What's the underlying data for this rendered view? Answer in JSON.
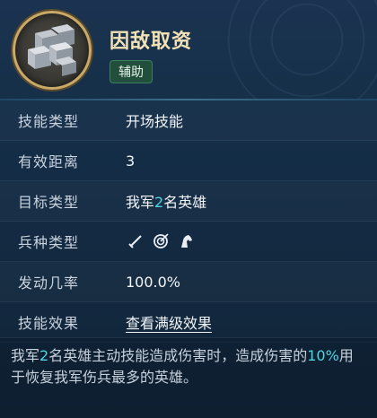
{
  "skill": {
    "name": "因敌取资",
    "tag": "辅助",
    "icon": "stacked-ingots-icon"
  },
  "rows": [
    {
      "key": "技能类型",
      "value": "开场技能"
    },
    {
      "key": "有效距离",
      "value": "3"
    },
    {
      "key": "目标类型",
      "value_prefix": "我军",
      "value_accent": "2",
      "value_suffix": "名英雄"
    },
    {
      "key": "兵种类型",
      "icons": [
        "sword-icon",
        "bow-target-icon",
        "horse-head-icon"
      ]
    },
    {
      "key": "发动几率",
      "value": "100.0%"
    },
    {
      "key": "技能效果",
      "link": "查看满级效果"
    }
  ],
  "description": {
    "part1": "我军",
    "num1": "2",
    "part2": "名英雄主动技能造成伤害时，造成伤害的",
    "num2": "10%",
    "part3": "用于恢复我军伤兵最多的英雄。"
  },
  "colors": {
    "accent": "#4fd6df",
    "title": "#f3e2b6",
    "tag_bg": "#224f3c",
    "ring": "#c9a968"
  }
}
